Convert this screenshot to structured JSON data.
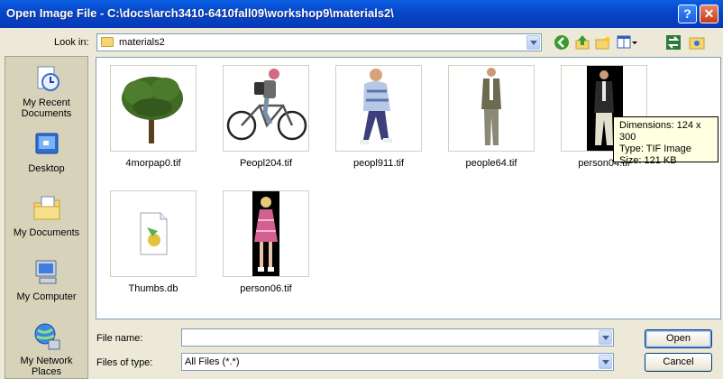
{
  "window": {
    "title": "Open Image File - C:\\docs\\arch3410-6410fall09\\workshop9\\materials2\\",
    "help_glyph": "?",
    "close_glyph": "✕"
  },
  "lookin": {
    "label": "Look in:",
    "value": "materials2"
  },
  "toolbar": {
    "icons": [
      "back-icon",
      "up-folder-icon",
      "new-folder-icon",
      "views-menu-icon",
      "refresh-icon",
      "folder-settings-icon"
    ]
  },
  "places": [
    {
      "label": "My Recent Documents"
    },
    {
      "label": "Desktop"
    },
    {
      "label": "My Documents"
    },
    {
      "label": "My Computer"
    },
    {
      "label": "My Network Places"
    }
  ],
  "files": [
    {
      "name": "4morpap0.tif"
    },
    {
      "name": "Peopl204.tif"
    },
    {
      "name": "peopl911.tif"
    },
    {
      "name": "people64.tif"
    },
    {
      "name": "person04.tif"
    },
    {
      "name": "Thumbs.db"
    },
    {
      "name": "person06.tif"
    }
  ],
  "tooltip": {
    "dimensions": "Dimensions: 124 x 300",
    "type": "Type: TIF Image",
    "size": "Size: 121 KB"
  },
  "form": {
    "filename_label": "File name:",
    "filename_value": "",
    "filetype_label": "Files of type:",
    "filetype_value": "All Files (*.*)"
  },
  "buttons": {
    "open": "Open",
    "cancel": "Cancel"
  },
  "colors": {
    "titlebar": "#0845c9",
    "dialog_bg": "#ece9d8",
    "tooltip_bg": "#ffffe1"
  }
}
